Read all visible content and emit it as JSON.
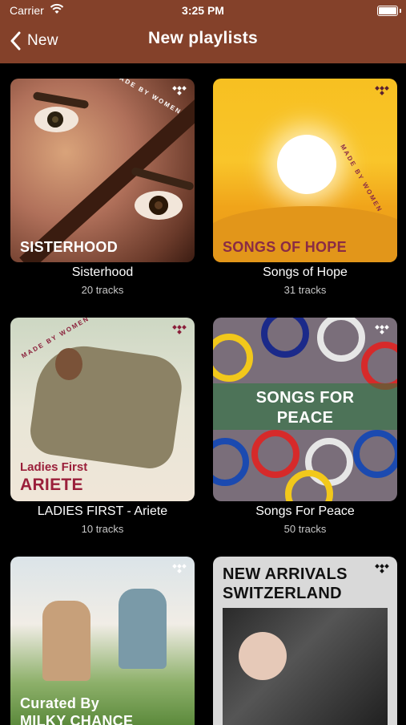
{
  "status_bar": {
    "carrier": "Carrier",
    "time": "3:25 PM"
  },
  "nav": {
    "back_label": "New",
    "title": "New playlists"
  },
  "colors": {
    "header_bg": "#84412a",
    "background": "#000000"
  },
  "playlists": [
    {
      "cover_text": "SISTERHOOD",
      "ring_text": "MADE BY WOMEN",
      "name": "Sisterhood",
      "tracks": "20 tracks"
    },
    {
      "cover_text": "SONGS OF HOPE",
      "ring_text": "MADE BY WOMEN",
      "name": "Songs of Hope",
      "tracks": "31 tracks"
    },
    {
      "cover_subtext": "Ladies First",
      "cover_text": "ARIETE",
      "ring_text": "MADE BY WOMEN",
      "name": "LADIES FIRST - Ariete",
      "tracks": "10 tracks"
    },
    {
      "cover_text": "SONGS FOR PEACE",
      "name": "Songs For Peace",
      "tracks": "50 tracks"
    },
    {
      "cover_text": "Curated By MILKY CHANCE"
    },
    {
      "cover_text": "NEW ARRIVALS SWITZERLAND"
    }
  ]
}
